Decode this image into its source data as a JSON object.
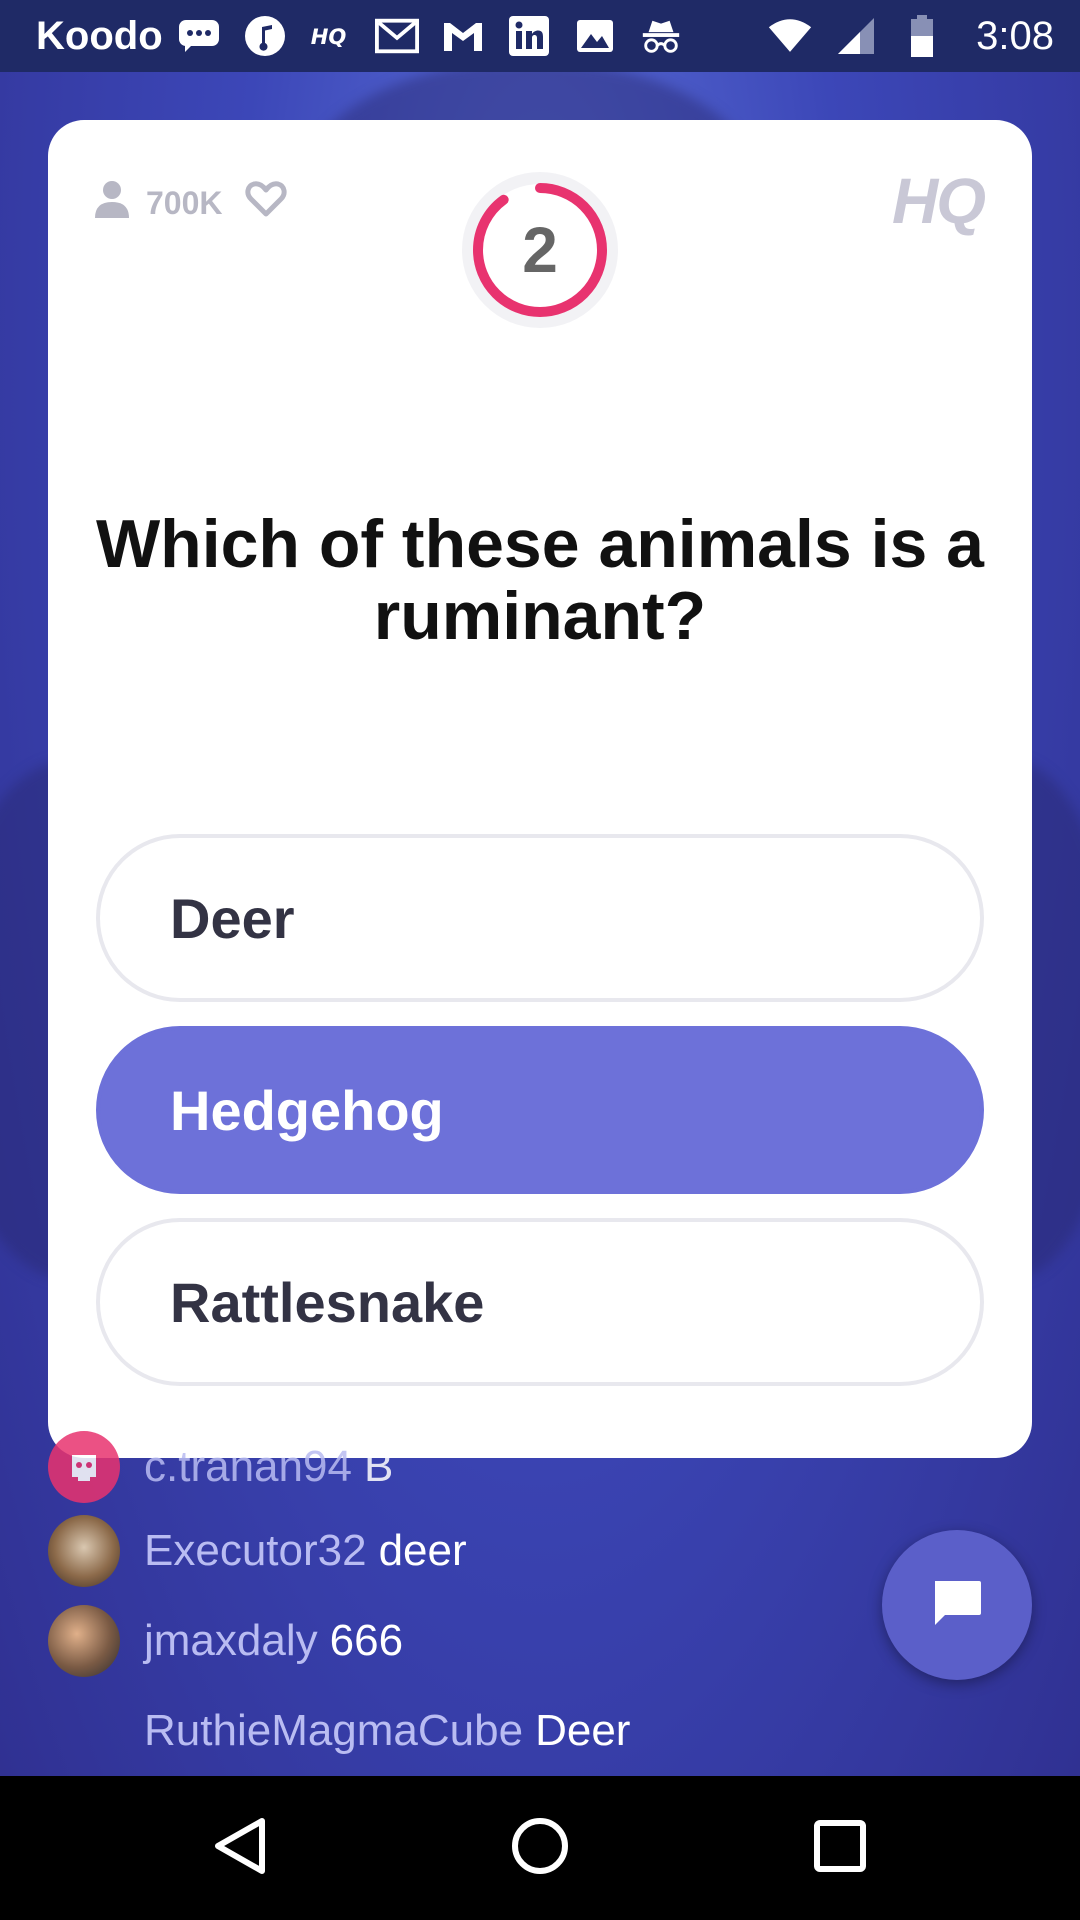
{
  "status_bar": {
    "carrier": "Koodo",
    "time": "3:08",
    "icons": [
      "chat-bubble-icon",
      "music-icon",
      "hq-icon",
      "gmail-icon",
      "gmail-icon",
      "linkedin-icon",
      "image-icon",
      "incognito-icon",
      "wifi-icon",
      "signal-icon",
      "battery-icon"
    ]
  },
  "card": {
    "player_count": "700K",
    "timer_value": "2",
    "timer_remaining_fraction": 0.9,
    "logo_text": "HQ",
    "question": "Which of these animals is a ruminant?",
    "answers": [
      {
        "label": "Deer",
        "selected": false
      },
      {
        "label": "Hedgehog",
        "selected": true
      },
      {
        "label": "Rattlesnake",
        "selected": false
      }
    ]
  },
  "chat": {
    "messages": [
      {
        "user": "c.tranan94",
        "text": "B"
      },
      {
        "user": "Executor32",
        "text": "deer"
      },
      {
        "user": "jmaxdaly",
        "text": "666"
      },
      {
        "user": "RuthieMagmaCube",
        "text": "Deer"
      }
    ]
  },
  "colors": {
    "accent": "#6d71d9",
    "timer_ring": "#e8336f",
    "background": "#3c47b8",
    "status_bar": "#1f2a66"
  },
  "nav_bar": {
    "buttons": [
      "back-icon",
      "home-icon",
      "recents-icon"
    ]
  }
}
